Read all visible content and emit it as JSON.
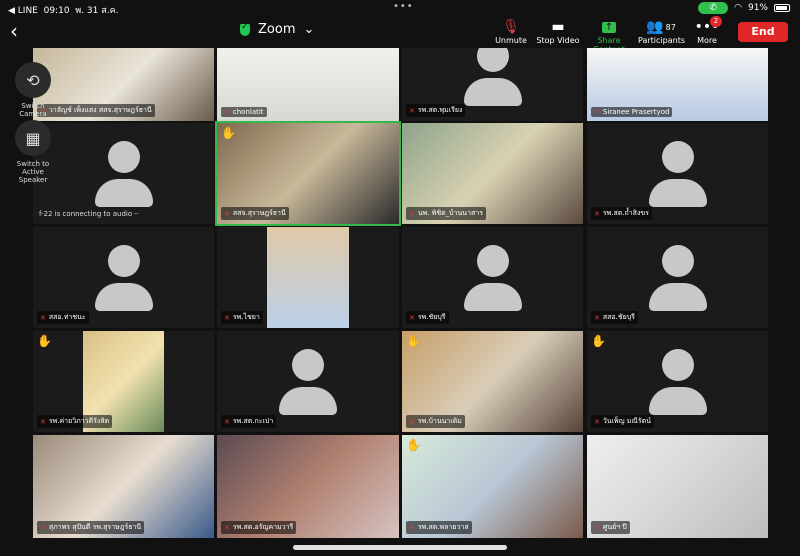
{
  "status_bar": {
    "back_app": "◀ LINE",
    "time": "09:10",
    "date": "พ. 31 ส.ค.",
    "dots": "•••",
    "battery": "91%"
  },
  "meeting": {
    "title": "Zoom"
  },
  "toolbar": {
    "unmute": "Unmute",
    "stop_video": "Stop Video",
    "share_content": "Share Content",
    "participants": "Participants",
    "participants_count": "87",
    "more": "More",
    "more_badge": "2",
    "end": "End"
  },
  "side_controls": {
    "switch_camera": "Switch Camera",
    "switch_active_speaker": "Switch to Active Speaker"
  },
  "connecting_text": "f-22 is connecting to audio -·",
  "tiles": [
    {
      "name": "วาลัญช์ เพ็งแสง สสจ.สุราษฎร์ธานี",
      "kind": "photo",
      "wave": false
    },
    {
      "name": "chonlatit",
      "kind": "photo",
      "wave": false
    },
    {
      "name": "รพ.สต.พุมเรียง",
      "kind": "avatar",
      "wave": false
    },
    {
      "name": "Siranee Prasertyod",
      "kind": "photo",
      "wave": false
    },
    {
      "name": "",
      "kind": "avatar",
      "wave": false
    },
    {
      "name": "สสจ.สุราษฎร์ธานี",
      "kind": "photo",
      "wave": true
    },
    {
      "name": "นพ. พิชิต_บ้านนาสาร",
      "kind": "photo",
      "wave": false
    },
    {
      "name": "รพ.สต.ถ้ำสิงขร",
      "kind": "avatar",
      "wave": false
    },
    {
      "name": "สสอ.ท่าชนะ",
      "kind": "avatar",
      "wave": false
    },
    {
      "name": "รพ.ไชยา",
      "kind": "photo",
      "wave": false
    },
    {
      "name": "รพ.ชัยบุรี",
      "kind": "avatar",
      "wave": false
    },
    {
      "name": "สสอ.ชัยบุรี",
      "kind": "avatar",
      "wave": false
    },
    {
      "name": "รพ.ค่ายวิภาวดีรังสิต",
      "kind": "photo",
      "wave": true
    },
    {
      "name": "รพ.สต.กะเปา",
      "kind": "avatar",
      "wave": false
    },
    {
      "name": "รพ.บ้านนาเดิม",
      "kind": "photo",
      "wave": true
    },
    {
      "name": "วันเพ็ญ มณีรัตน์",
      "kind": "avatar",
      "wave": true
    },
    {
      "name": "สุภาพร สุปันตี รพ.สุราษฎร์ธานี",
      "kind": "photo",
      "wave": false
    },
    {
      "name": "รพ.สต.อรัญคามวารี",
      "kind": "photo",
      "wave": false
    },
    {
      "name": "รพ.สต.พลายวาส",
      "kind": "photo",
      "wave": true
    },
    {
      "name": "ศูนย์ฯ ปี",
      "kind": "photo",
      "wave": false
    }
  ]
}
